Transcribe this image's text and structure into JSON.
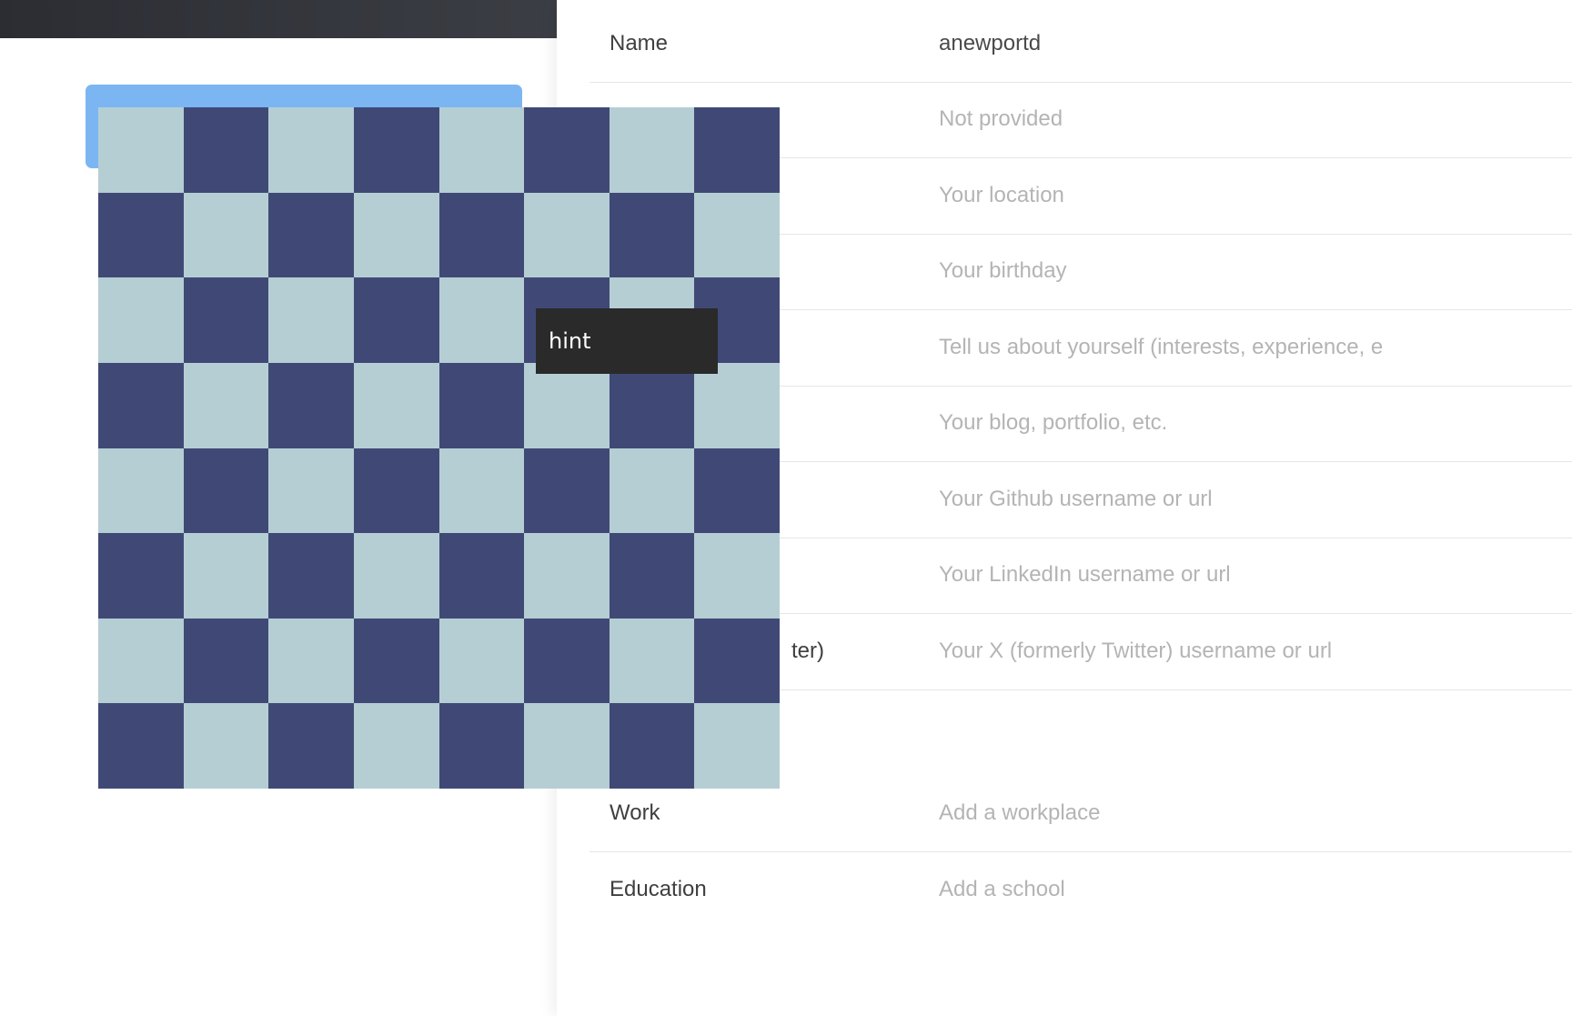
{
  "profile": {
    "rows": [
      {
        "label": "Name",
        "value": "anewportd",
        "filled": true
      },
      {
        "label": "",
        "value": "Not provided",
        "filled": false
      },
      {
        "label": "",
        "value": "Your location",
        "filled": false
      },
      {
        "label": "",
        "value": "Your birthday",
        "filled": false
      },
      {
        "label": "",
        "value": "Tell us about yourself (interests, experience, e",
        "filled": false
      },
      {
        "label": "",
        "value": "Your blog, portfolio, etc.",
        "filled": false
      },
      {
        "label": "",
        "value": "Your Github username or url",
        "filled": false
      },
      {
        "label": "",
        "value": "Your LinkedIn username or url",
        "filled": false
      },
      {
        "label": "ter)",
        "value": "Your X (formerly Twitter) username or url",
        "filled": false
      },
      {
        "label": "Work",
        "value": "Add a workplace",
        "filled": false
      },
      {
        "label": "Education",
        "value": "Add a school",
        "filled": false
      }
    ]
  },
  "chessboard": {
    "rows": 8,
    "cols": 8,
    "light_color": "#b5ced4",
    "dark_color": "#404976"
  },
  "hint_button": {
    "label": "hint"
  },
  "colors": {
    "topbar": "#2b2d33",
    "accent_tab": "#7bb6f2"
  }
}
